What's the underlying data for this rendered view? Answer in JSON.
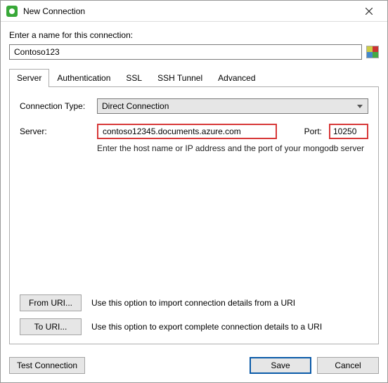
{
  "window": {
    "title": "New Connection"
  },
  "prompt": "Enter a name for this connection:",
  "connection_name": "Contoso123",
  "tabs": [
    {
      "label": "Server"
    },
    {
      "label": "Authentication"
    },
    {
      "label": "SSL"
    },
    {
      "label": "SSH Tunnel"
    },
    {
      "label": "Advanced"
    }
  ],
  "server_tab": {
    "connection_type_label": "Connection Type:",
    "connection_type_value": "Direct Connection",
    "server_label": "Server:",
    "server_value": "contoso12345.documents.azure.com",
    "port_label": "Port:",
    "port_value": "10250",
    "help_text": "Enter the host name or IP address and the port of your mongodb server",
    "from_uri_label": "From URI...",
    "from_uri_desc": "Use this option to import connection details from a URI",
    "to_uri_label": "To URI...",
    "to_uri_desc": "Use this option to export complete connection details to a URI"
  },
  "footer": {
    "test_connection": "Test Connection",
    "save": "Save",
    "cancel": "Cancel"
  }
}
